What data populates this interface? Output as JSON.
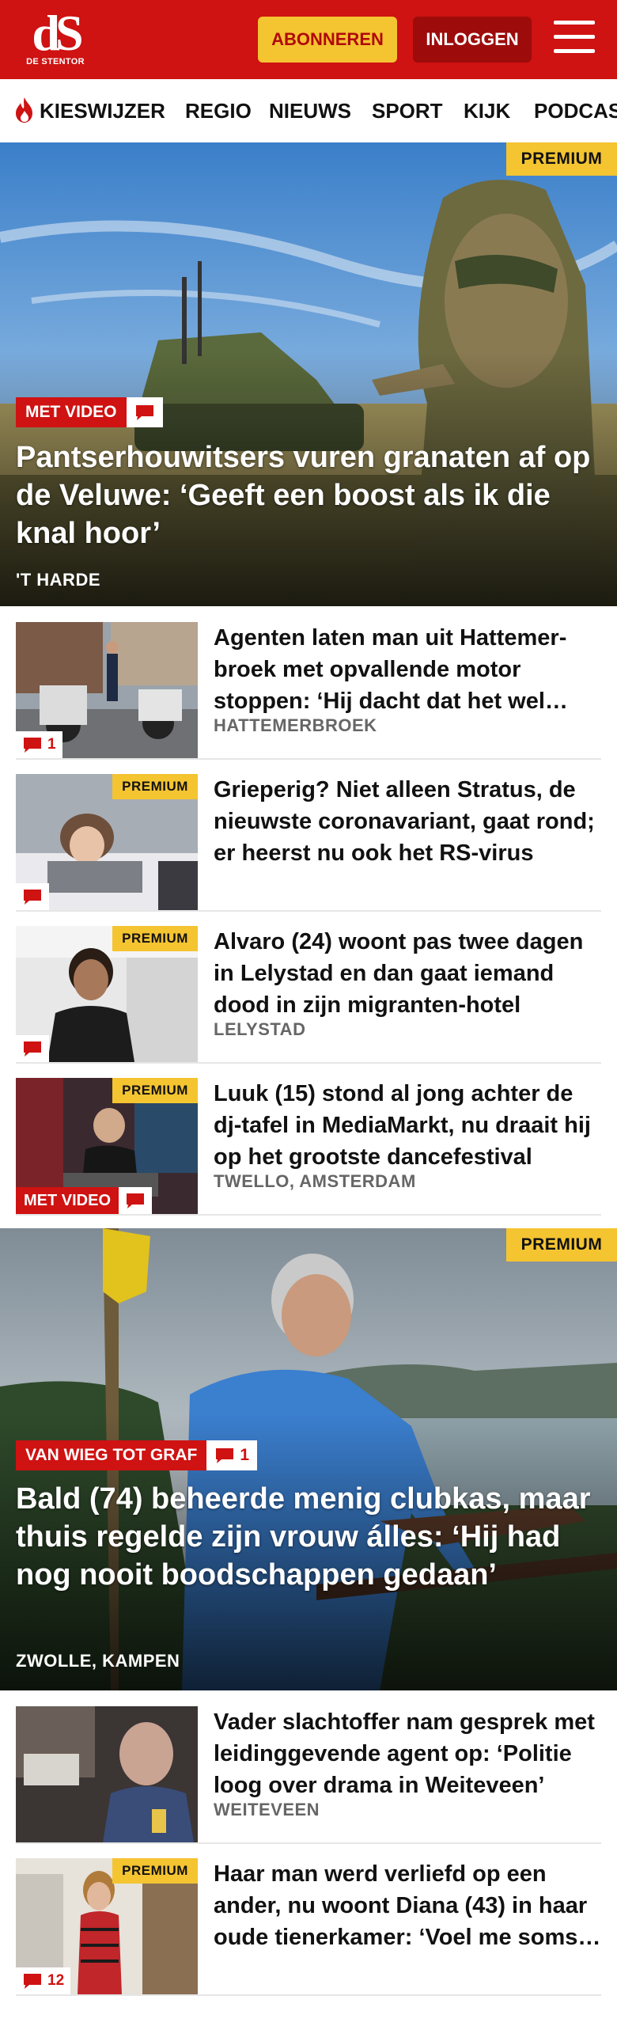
{
  "header": {
    "logo_mark": "dS",
    "logo_sub": "DE STENTOR",
    "subscribe_label": "ABONNEREN",
    "login_label": "INLOGGEN",
    "menu_icon": "hamburger-menu-icon",
    "brand_color": "#cf1212",
    "accent_color": "#f4c431"
  },
  "nav": {
    "items": [
      {
        "label": "KIESWIJZER",
        "icon": "flame-icon"
      },
      {
        "label": "REGIO"
      },
      {
        "label": "NIEUWS"
      },
      {
        "label": "SPORT"
      },
      {
        "label": "KIJK"
      },
      {
        "label": "PODCAS"
      }
    ]
  },
  "articles": {
    "hero1": {
      "badge": "PREMIUM",
      "tag": "MET VIDEO",
      "title": "Pantserhouwitsers vuren granaten af op de Veluwe: ‘Geeft een boost als ik die knal hoor’",
      "location": "'T HARDE"
    },
    "list1": [
      {
        "title": "Agenten laten man uit Hattemer­broek met opvallende motor stoppen: ‘Hij dacht dat het wel moest kunnen’",
        "location": "HATTEMERBROEK",
        "comments": "1",
        "badge": "",
        "tag": ""
      },
      {
        "title": "Grieperig? Niet alleen Stratus, de nieuwste coronavariant, gaat rond; er heerst nu ook het RS-virus",
        "location": "",
        "comments": "",
        "badge": "PREMIUM",
        "tag": ""
      },
      {
        "title": "Alvaro (24) woont pas twee dagen in Lelystad en dan gaat iemand dood in zijn migranten-hotel",
        "location": "LELYSTAD",
        "comments": "",
        "badge": "PREMIUM",
        "tag": ""
      },
      {
        "title": "Luuk (15) stond al jong achter de dj-tafel in MediaMarkt, nu draait hij op het grootste dancefestival",
        "location": "TWELLO, AMSTERDAM",
        "comments": "",
        "badge": "PREMIUM",
        "tag": "MET VIDEO"
      }
    ],
    "hero2": {
      "badge": "PREMIUM",
      "tag": "VAN WIEG TOT GRAF",
      "comments": "1",
      "title": "Bald (74) beheerde menig clubkas, maar thuis regelde zijn vrouw álles: ‘Hij had nog nooit boodschappen gedaan’",
      "location": "ZWOLLE, KAMPEN"
    },
    "list2": [
      {
        "title": "Vader slachtoffer nam gesprek met leidinggevende agent op: ‘Politie loog over drama in Weiteveen’",
        "location": "WEITEVEEN",
        "comments": "",
        "badge": "",
        "tag": ""
      },
      {
        "title": "Haar man werd verliefd op een ander, nu woont Diana (43) in haar oude tienerkamer: ‘Voel me soms een puber’",
        "location": "",
        "comments": "12",
        "badge": "PREMIUM",
        "tag": ""
      }
    ]
  }
}
